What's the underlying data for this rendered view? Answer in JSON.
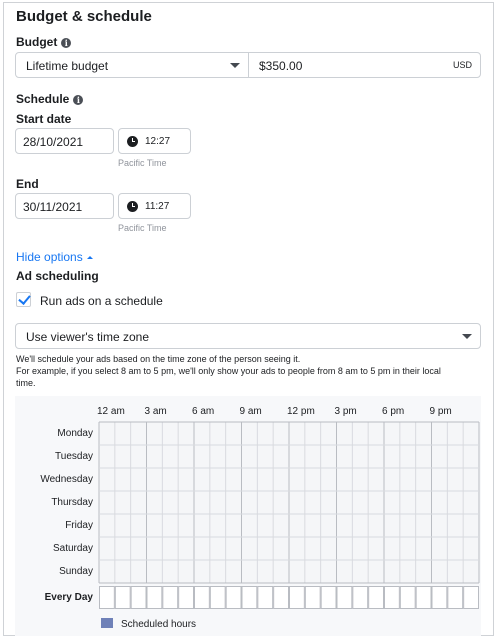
{
  "section_title": "Budget & schedule",
  "budget": {
    "label": "Budget",
    "type_value": "Lifetime budget",
    "amount": "$350.00",
    "currency": "USD"
  },
  "schedule": {
    "label": "Schedule",
    "start_label": "Start date",
    "start_date": "28/10/2021",
    "start_time": "12:27",
    "end_label": "End",
    "end_date": "30/11/2021",
    "end_time": "11:27",
    "timezone_note": "Pacific Time"
  },
  "options_link": "Hide options",
  "ad_scheduling": {
    "label": "Ad scheduling",
    "checkbox_label": "Run ads on a schedule",
    "checked": true,
    "timezone_select": "Use viewer's time zone",
    "help_lines": [
      "We'll schedule your ads based on the time zone of the person seeing it.",
      "For example, if you select 8 am to 5 pm, we'll only show your ads to people from 8 am to 5 pm in their local",
      "time."
    ]
  },
  "grid": {
    "time_labels": [
      "12 am",
      "3 am",
      "6 am",
      "9 am",
      "12 pm",
      "3 pm",
      "6 pm",
      "9 pm"
    ],
    "days": [
      "Monday",
      "Tuesday",
      "Wednesday",
      "Thursday",
      "Friday",
      "Saturday",
      "Sunday"
    ],
    "every_day_label": "Every Day",
    "legend_label": "Scheduled hours",
    "legend_color": "#6f81b8"
  },
  "colors": {
    "accent": "#1877f2",
    "border": "#ccd0d5",
    "grid_line": "#d8dadf",
    "grid_line_major": "#b9bcc2"
  }
}
